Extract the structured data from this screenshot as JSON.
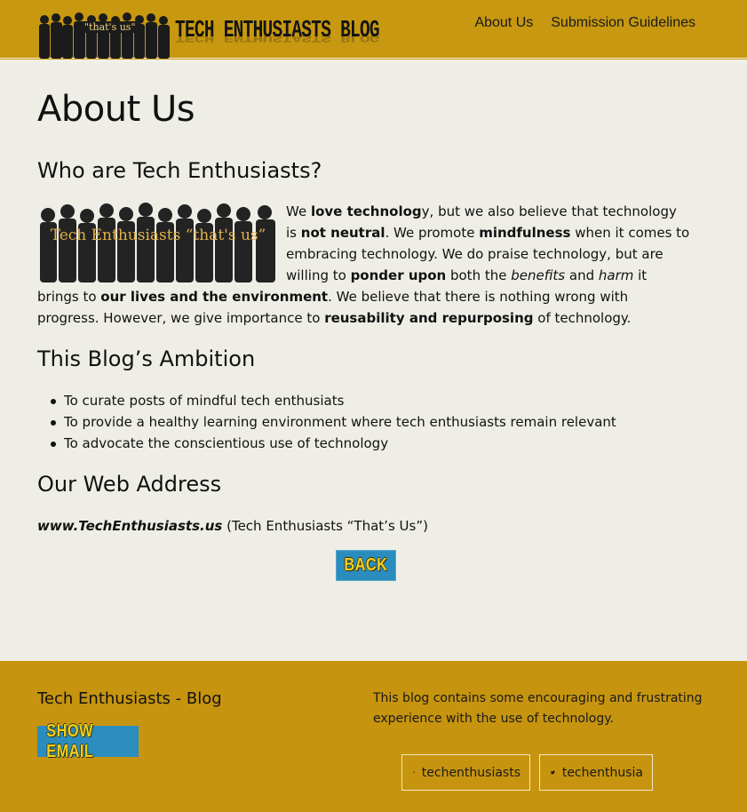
{
  "header": {
    "logo_badge": "\"that's us\"",
    "logo_title": "TECH ENTHUSIASTS BLOG",
    "nav": [
      {
        "label": "About Us"
      },
      {
        "label": "Submission Guidelines"
      }
    ]
  },
  "main": {
    "page_title": "About Us",
    "who": {
      "heading": "Who are Tech Enthusiasts?",
      "image_text": "Tech Enthusiasts “that's us”",
      "p1": "We ",
      "b1": "love technolog",
      "p2": "y, but we also believe that technology is ",
      "b2": "not neutral",
      "p3": ". We promote ",
      "b3": "mindfulness",
      "p4": " when it comes to embracing technology. We do praise technology, but are willing to ",
      "b4": "ponder upon",
      "p5": " both the ",
      "i1": "benefits",
      "p6": " and ",
      "i2": "harm",
      "p7": " it brings to ",
      "b5": "our lives and the environment",
      "p8": ". We believe that there is nothing wrong with progress. However, we give importance to ",
      "b6": "reusability and repurposing",
      "p9": " of technology."
    },
    "ambition": {
      "heading": "This Blog’s Ambition",
      "items": [
        "To curate posts of mindful tech enthusiats",
        "To provide a healthy learning environment where tech enthusiasts remain relevant",
        "To advocate the conscientious use of technology"
      ]
    },
    "web": {
      "heading": "Our Web Address",
      "url": "www.TechEnthusiasts.us",
      "note": " (Tech Enthusiasts “That’s Us”)"
    },
    "back_label": "BACK"
  },
  "footer": {
    "title": "Tech Enthusiasts - Blog",
    "show_email_label": "SHOW EMAIL",
    "description": "This blog contains some encouraging and frustrating experience with the use of technology.",
    "github_label": "techenthusiasts",
    "twitter_label": "techenthusia"
  },
  "colors": {
    "gold": "#c79810",
    "button_blue": "#2b8cbe",
    "button_text_yellow": "#f0cf1e"
  },
  "icons": {
    "github": "github-icon",
    "twitter": "twitter-icon"
  }
}
